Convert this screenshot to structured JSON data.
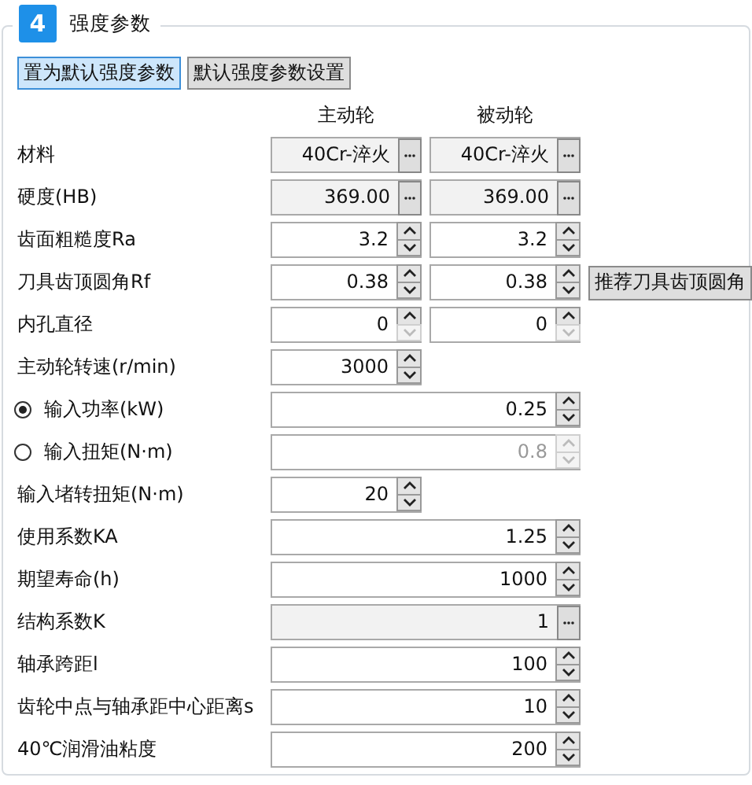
{
  "section": {
    "number": "4",
    "title": "强度参数"
  },
  "buttons": [
    {
      "label": "置为默认强度参数",
      "selected": true
    },
    {
      "label": "默认强度参数设置",
      "selected": false
    }
  ],
  "columns": [
    "主动轮",
    "被动轮"
  ],
  "rows": [
    {
      "label": "材料",
      "fields": [
        {
          "kind": "picker",
          "value": "40Cr-淬火",
          "wide": false
        },
        {
          "kind": "picker",
          "value": "40Cr-淬火",
          "wide": false
        }
      ]
    },
    {
      "label": "硬度(HB)",
      "fields": [
        {
          "kind": "picker",
          "value": "369.00",
          "wide": false
        },
        {
          "kind": "picker",
          "value": "369.00",
          "wide": false
        }
      ]
    },
    {
      "label": "齿面粗糙度Ra",
      "fields": [
        {
          "kind": "spin",
          "value": "3.2",
          "wide": false,
          "disabled": false,
          "down_disabled": false
        },
        {
          "kind": "spin",
          "value": "3.2",
          "wide": false,
          "disabled": false,
          "down_disabled": false
        }
      ]
    },
    {
      "label": "刀具齿顶圆角Rf",
      "fields": [
        {
          "kind": "spin",
          "value": "0.38",
          "wide": false,
          "disabled": false,
          "down_disabled": false
        },
        {
          "kind": "spin",
          "value": "0.38",
          "wide": false,
          "disabled": false,
          "down_disabled": false
        }
      ],
      "button": "推荐刀具齿顶圆角"
    },
    {
      "label": "内孔直径",
      "fields": [
        {
          "kind": "spin",
          "value": "0",
          "wide": false,
          "disabled": false,
          "down_disabled": true
        },
        {
          "kind": "spin",
          "value": "0",
          "wide": false,
          "disabled": false,
          "down_disabled": true
        }
      ]
    },
    {
      "label": "主动轮转速(r/min)",
      "fields": [
        {
          "kind": "spin",
          "value": "3000",
          "wide": false,
          "disabled": false,
          "down_disabled": false
        }
      ]
    },
    {
      "label": "输入功率(kW)",
      "radio": {
        "selected": true
      },
      "fields": [
        {
          "kind": "spin",
          "value": "0.25",
          "wide": true,
          "disabled": false,
          "down_disabled": false
        }
      ]
    },
    {
      "label": "输入扭矩(N·m)",
      "radio": {
        "selected": false
      },
      "fields": [
        {
          "kind": "spin",
          "value": "0.8",
          "wide": true,
          "disabled": true,
          "down_disabled": true
        }
      ]
    },
    {
      "label": "输入堵转扭矩(N·m)",
      "fields": [
        {
          "kind": "spin",
          "value": "20",
          "wide": false,
          "disabled": false,
          "down_disabled": false
        }
      ]
    },
    {
      "label": "使用系数KA",
      "fields": [
        {
          "kind": "spin",
          "value": "1.25",
          "wide": true,
          "disabled": false,
          "down_disabled": false
        }
      ]
    },
    {
      "label": "期望寿命(h)",
      "fields": [
        {
          "kind": "spin",
          "value": "1000",
          "wide": true,
          "disabled": false,
          "down_disabled": false
        }
      ]
    },
    {
      "label": "结构系数K",
      "fields": [
        {
          "kind": "picker",
          "value": "1",
          "wide": true
        }
      ]
    },
    {
      "label": "轴承跨距l",
      "fields": [
        {
          "kind": "spin",
          "value": "100",
          "wide": true,
          "disabled": false,
          "down_disabled": false
        }
      ]
    },
    {
      "label": "齿轮中点与轴承距中心距离s",
      "fields": [
        {
          "kind": "spin",
          "value": "10",
          "wide": true,
          "disabled": false,
          "down_disabled": false
        }
      ]
    },
    {
      "label": "40℃润滑油粘度",
      "fields": [
        {
          "kind": "spin",
          "value": "200",
          "wide": true,
          "disabled": false,
          "down_disabled": false
        }
      ]
    }
  ]
}
